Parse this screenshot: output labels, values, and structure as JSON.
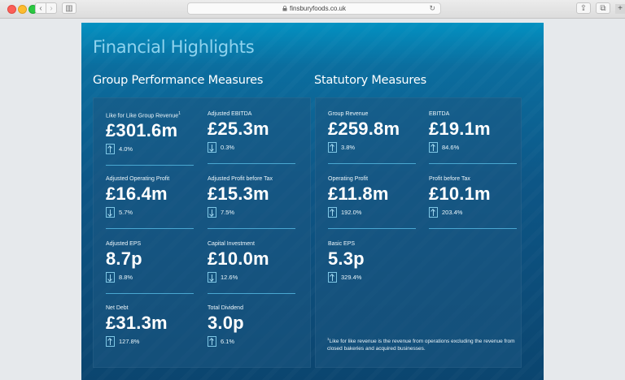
{
  "browser": {
    "url": "finsburyfoods.co.uk",
    "back_glyph": "‹",
    "forward_glyph": "›",
    "sidebar_glyph": "▥",
    "reload_glyph": "↻",
    "share_glyph": "⇪",
    "tabs_glyph": "⧉",
    "newtab_glyph": "+"
  },
  "page": {
    "title": "Financial Highlights",
    "group_section": {
      "title": "Group Performance Measures",
      "metrics": [
        {
          "label": "Like for Like Group Revenue",
          "superscript": "1",
          "value": "£301.6m",
          "direction": "up",
          "change": "4.0%"
        },
        {
          "label": "Adjusted EBITDA",
          "superscript": "",
          "value": "£25.3m",
          "direction": "down",
          "change": "0.3%"
        },
        {
          "label": "Adjusted Operating Profit",
          "superscript": "",
          "value": "£16.4m",
          "direction": "down",
          "change": "5.7%"
        },
        {
          "label": "Adjusted Profit before Tax",
          "superscript": "",
          "value": "£15.3m",
          "direction": "down",
          "change": "7.5%"
        },
        {
          "label": "Adjusted EPS",
          "superscript": "",
          "value": "8.7p",
          "direction": "down",
          "change": "8.8%"
        },
        {
          "label": "Capital Investment",
          "superscript": "",
          "value": "£10.0m",
          "direction": "down",
          "change": "12.6%"
        },
        {
          "label": "Net Debt",
          "superscript": "",
          "value": "£31.3m",
          "direction": "up",
          "change": "127.8%"
        },
        {
          "label": "Total Dividend",
          "superscript": "",
          "value": "3.0p",
          "direction": "up",
          "change": "6.1%"
        }
      ]
    },
    "statutory_section": {
      "title": "Statutory Measures",
      "metrics": [
        {
          "label": "Group Revenue",
          "value": "£259.8m",
          "direction": "up",
          "change": "3.8%"
        },
        {
          "label": "EBITDA",
          "value": "£19.1m",
          "direction": "up",
          "change": "84.6%"
        },
        {
          "label": "Operating Profit",
          "value": "£11.8m",
          "direction": "up",
          "change": "192.0%"
        },
        {
          "label": "Profit before Tax",
          "value": "£10.1m",
          "direction": "up",
          "change": "203.4%"
        },
        {
          "label": "Basic EPS",
          "value": "5.3p",
          "direction": "up",
          "change": "329.4%"
        }
      ],
      "footnote_marker": "1",
      "footnote": "Like for like revenue is the revenue from operations excluding the revenue from closed bakeries and acquired businesses."
    }
  }
}
